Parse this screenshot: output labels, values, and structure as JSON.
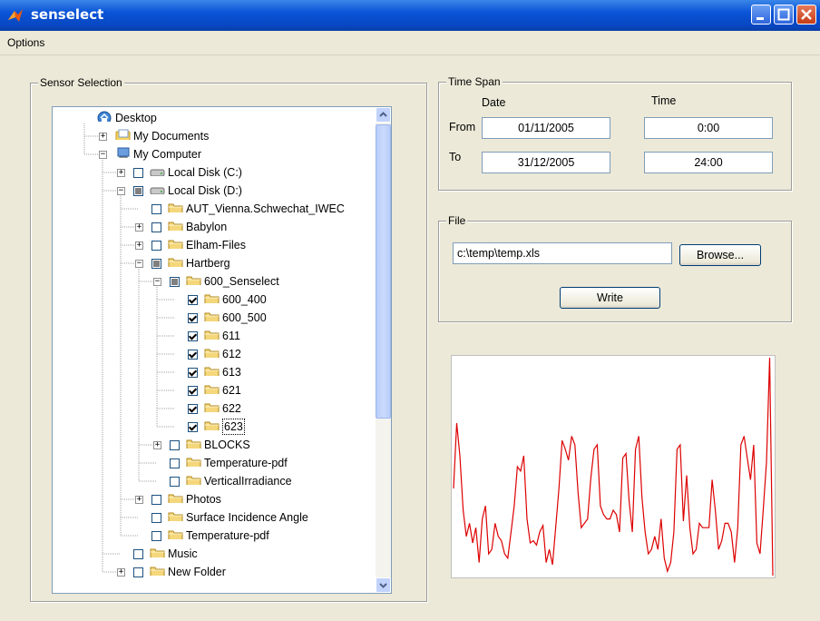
{
  "window": {
    "title": "senselect"
  },
  "menu": {
    "items": [
      "Options"
    ]
  },
  "sensor_selection": {
    "title": "Sensor Selection",
    "tree": [
      {
        "label": "Desktop",
        "level": 0,
        "icon": "desktop-icon",
        "expander": "none",
        "check": "none"
      },
      {
        "label": "My Documents",
        "level": 1,
        "icon": "my-documents-icon",
        "expander": "plus",
        "check": "none"
      },
      {
        "label": "My Computer",
        "level": 1,
        "icon": "my-computer-icon",
        "expander": "minus",
        "check": "none"
      },
      {
        "label": "Local Disk (C:)",
        "level": 2,
        "icon": "disk-icon",
        "expander": "plus",
        "check": "unchecked"
      },
      {
        "label": "Local Disk (D:)",
        "level": 2,
        "icon": "disk-icon",
        "expander": "minus",
        "check": "partial"
      },
      {
        "label": "AUT_Vienna.Schwechat_IWEC",
        "level": 3,
        "icon": "folder-icon",
        "expander": "none",
        "check": "unchecked"
      },
      {
        "label": "Babylon",
        "level": 3,
        "icon": "folder-icon",
        "expander": "plus",
        "check": "unchecked"
      },
      {
        "label": "Elham-Files",
        "level": 3,
        "icon": "folder-icon",
        "expander": "plus",
        "check": "unchecked"
      },
      {
        "label": "Hartberg",
        "level": 3,
        "icon": "folder-icon",
        "expander": "minus",
        "check": "partial"
      },
      {
        "label": "600_Senselect",
        "level": 4,
        "icon": "folder-icon",
        "expander": "minus",
        "check": "partial"
      },
      {
        "label": "600_400",
        "level": 5,
        "icon": "folder-icon",
        "expander": "none",
        "check": "checked"
      },
      {
        "label": "600_500",
        "level": 5,
        "icon": "folder-icon",
        "expander": "none",
        "check": "checked"
      },
      {
        "label": "611",
        "level": 5,
        "icon": "folder-icon",
        "expander": "none",
        "check": "checked"
      },
      {
        "label": "612",
        "level": 5,
        "icon": "folder-icon",
        "expander": "none",
        "check": "checked"
      },
      {
        "label": "613",
        "level": 5,
        "icon": "folder-icon",
        "expander": "none",
        "check": "checked"
      },
      {
        "label": "621",
        "level": 5,
        "icon": "folder-icon",
        "expander": "none",
        "check": "checked"
      },
      {
        "label": "622",
        "level": 5,
        "icon": "folder-icon",
        "expander": "none",
        "check": "checked"
      },
      {
        "label": "623",
        "level": 5,
        "icon": "folder-icon",
        "expander": "none",
        "check": "checked",
        "selected": true
      },
      {
        "label": "BLOCKS",
        "level": 4,
        "icon": "folder-icon",
        "expander": "plus",
        "check": "unchecked"
      },
      {
        "label": "Temperature-pdf",
        "level": 4,
        "icon": "folder-icon",
        "expander": "none",
        "check": "unchecked"
      },
      {
        "label": "VerticalIrradiance",
        "level": 4,
        "icon": "folder-icon",
        "expander": "none",
        "check": "unchecked"
      },
      {
        "label": "Photos",
        "level": 3,
        "icon": "folder-icon",
        "expander": "plus",
        "check": "unchecked"
      },
      {
        "label": "Surface Incidence Angle",
        "level": 3,
        "icon": "folder-icon",
        "expander": "none",
        "check": "unchecked"
      },
      {
        "label": "Temperature-pdf",
        "level": 3,
        "icon": "folder-icon",
        "expander": "none",
        "check": "unchecked"
      },
      {
        "label": "Music",
        "level": 2,
        "icon": "folder-icon",
        "expander": "none",
        "check": "unchecked"
      },
      {
        "label": "New Folder",
        "level": 2,
        "icon": "folder-icon",
        "expander": "plus",
        "check": "unchecked"
      }
    ]
  },
  "time_span": {
    "title": "Time Span",
    "date_header": "Date",
    "time_header": "Time",
    "from_label": "From",
    "to_label": "To",
    "from_date": "01/11/2005",
    "from_time": "0:00",
    "to_date": "31/12/2005",
    "to_time": "24:00"
  },
  "file": {
    "title": "File",
    "path": "c:\\temp\\temp.xls",
    "browse_label": "Browse...",
    "write_label": "Write"
  },
  "colors": {
    "plot_line": "#dd0000",
    "titlebar": "#0a54d8"
  },
  "chart_data": {
    "type": "line",
    "title": "",
    "xlabel": "",
    "ylabel": "",
    "series": [
      {
        "values": [
          40,
          70,
          55,
          30,
          18,
          24,
          15,
          22,
          6,
          26,
          32,
          10,
          12,
          24,
          18,
          16,
          10,
          8,
          20,
          32,
          50,
          48,
          55,
          26,
          15,
          16,
          14,
          20,
          23,
          6,
          12,
          5,
          22,
          40,
          62,
          58,
          53,
          64,
          60,
          38,
          22,
          24,
          26,
          45,
          58,
          60,
          32,
          28,
          26,
          26,
          30,
          28,
          20,
          54,
          56,
          34,
          20,
          58,
          64,
          36,
          20,
          10,
          12,
          18,
          12,
          26,
          8,
          2,
          6,
          20,
          58,
          60,
          25,
          46,
          22,
          10,
          12,
          24,
          22,
          22,
          22,
          44,
          30,
          12,
          16,
          24,
          24,
          20,
          6,
          22,
          60,
          64,
          54,
          44,
          60,
          15,
          10,
          30,
          52,
          100,
          0
        ]
      }
    ]
  }
}
